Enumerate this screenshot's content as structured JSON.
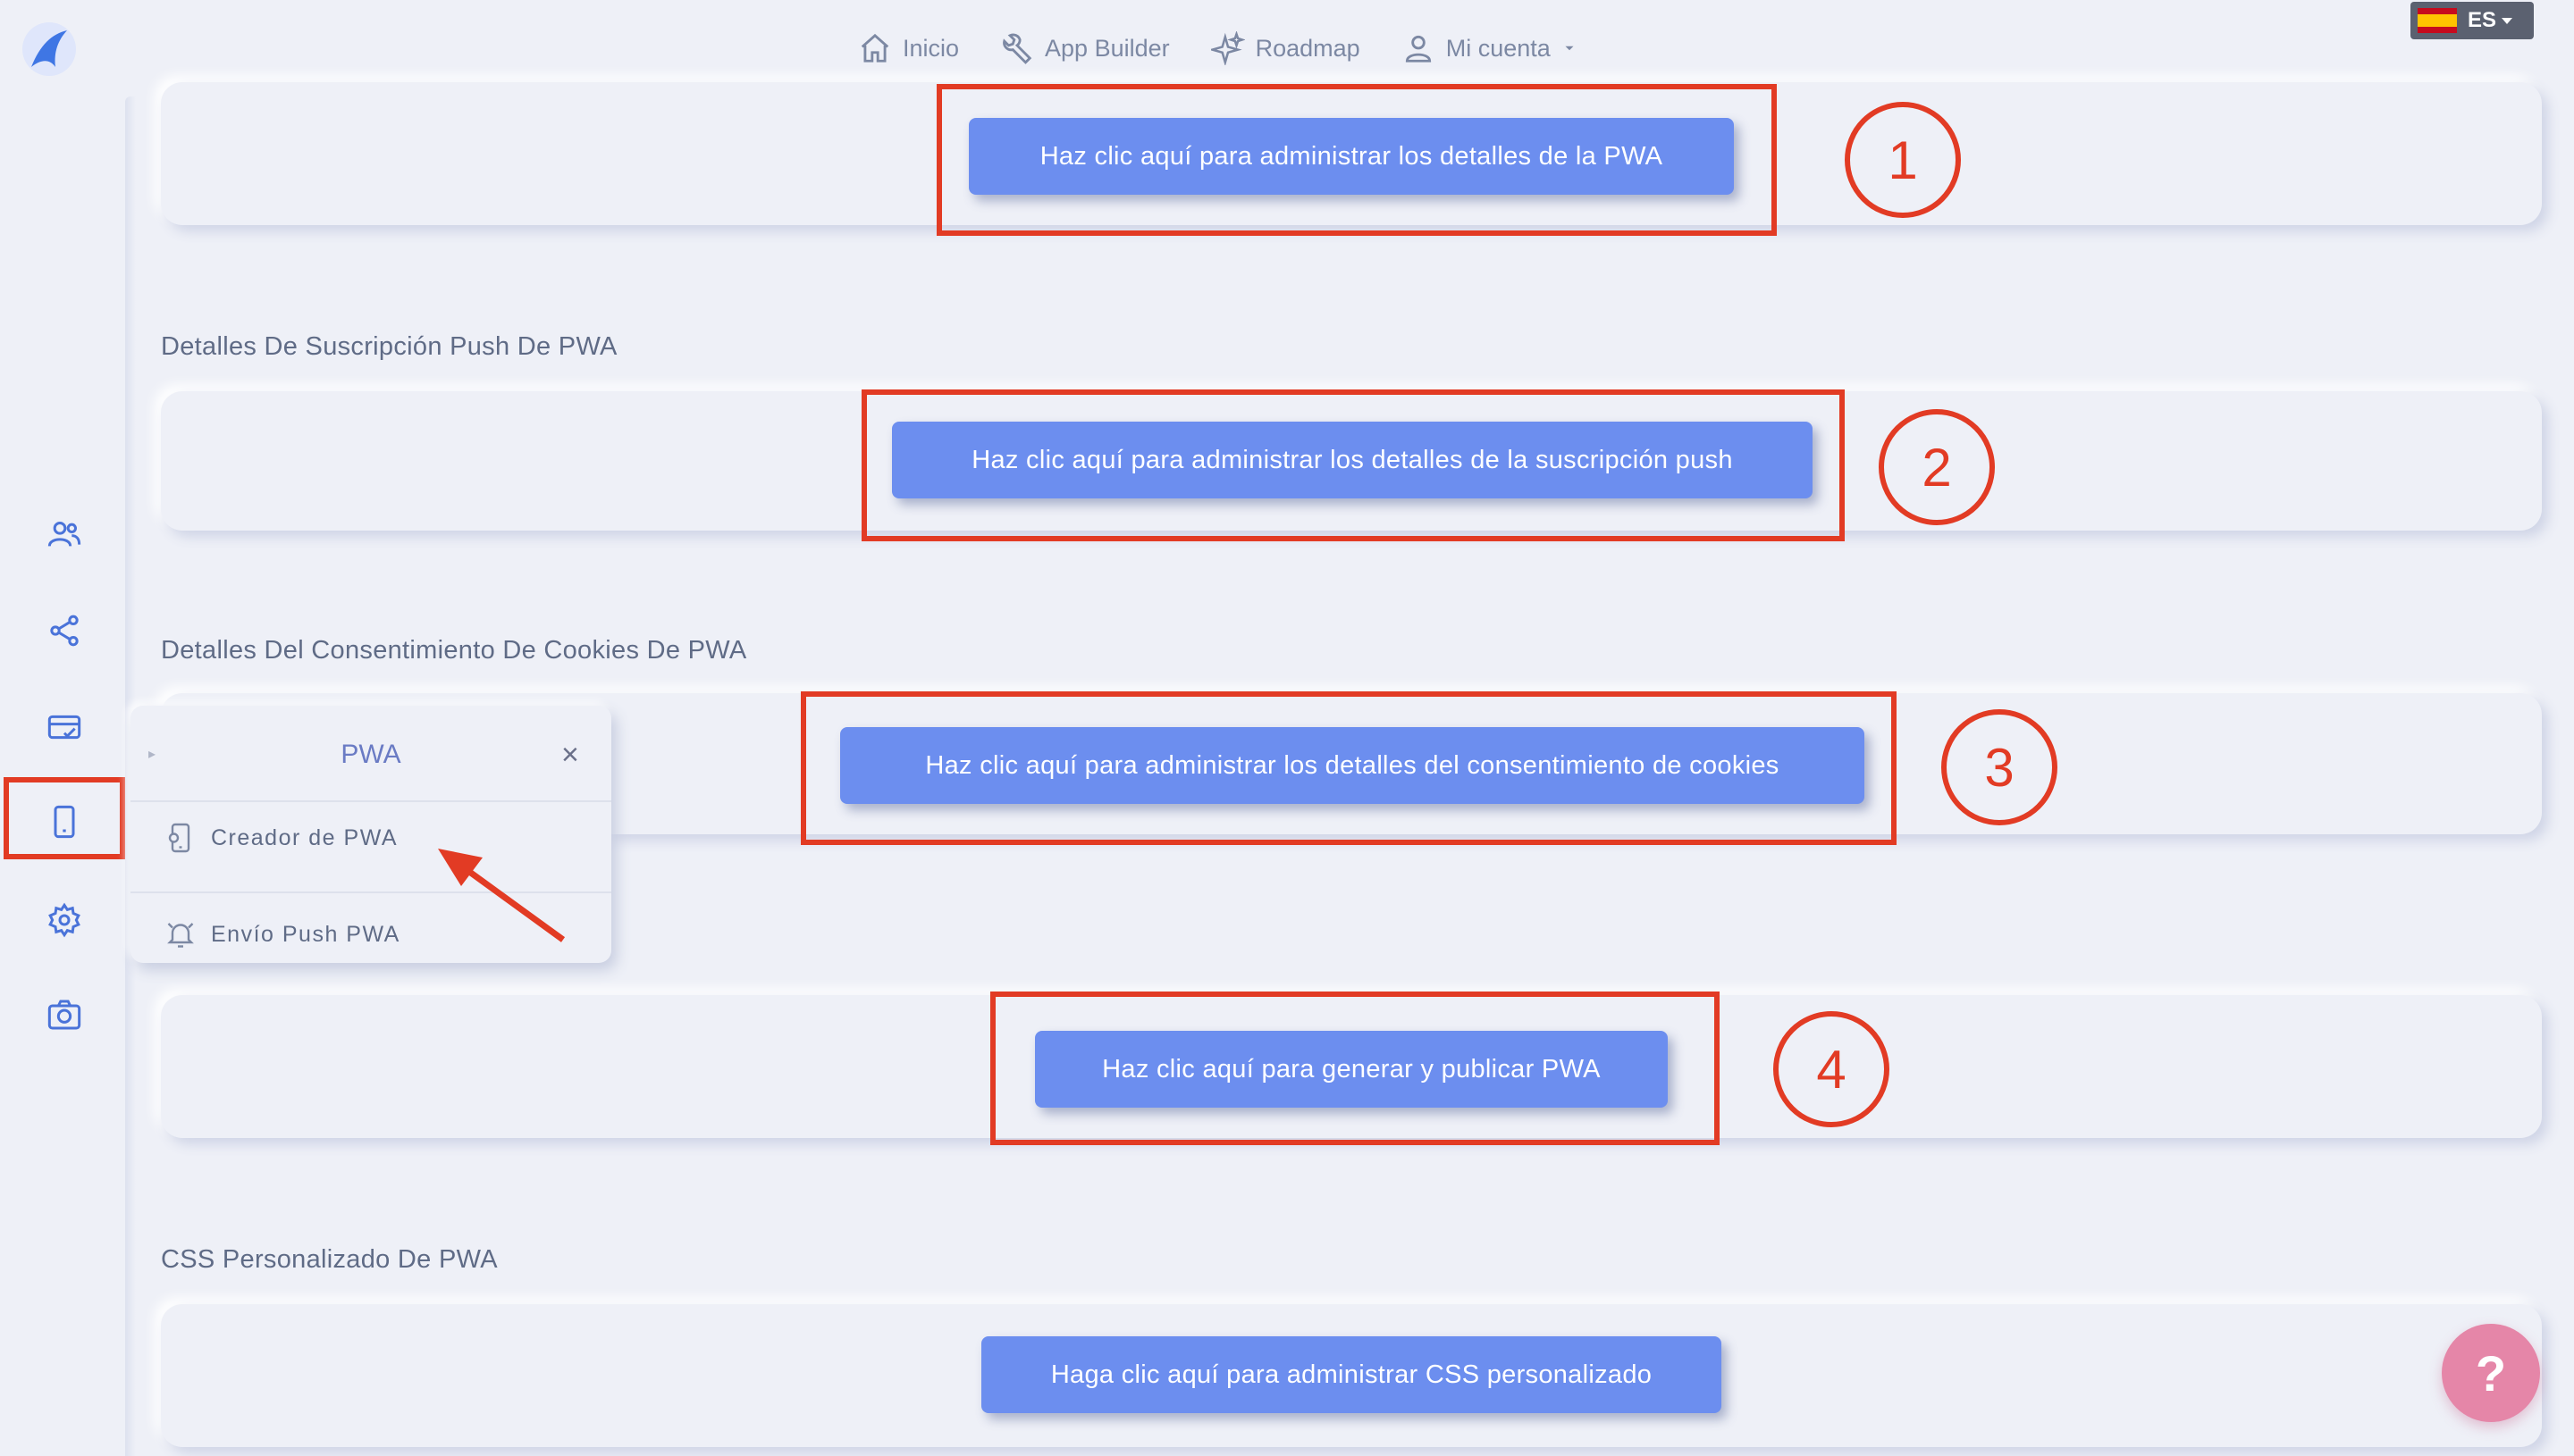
{
  "nav": {
    "inicio": "Inicio",
    "app_builder": "App Builder",
    "roadmap": "Roadmap",
    "mi_cuenta": "Mi cuenta",
    "language": "ES"
  },
  "sections": {
    "push_label": "Detalles De Suscripción Push De PWA",
    "cookies_label": "Detalles Del Consentimiento De Cookies De PWA",
    "css_label": "CSS Personalizado De PWA"
  },
  "buttons": {
    "pwa_details": "Haz clic aquí para administrar los detalles de la PWA",
    "push_details": "Haz clic aquí para administrar los detalles de la suscripción push",
    "cookie_details": "Haz clic aquí para administrar los detalles del consentimiento de cookies",
    "generate_publish": "Haz clic aquí para generar y publicar PWA",
    "custom_css": "Haga clic aquí para administrar CSS personalizado"
  },
  "annotations": {
    "step1": "1",
    "step2": "2",
    "step3": "3",
    "step4": "4"
  },
  "popup": {
    "title": "PWA",
    "close": "×",
    "item_creator": "Creador de PWA",
    "item_push": "Envío Push PWA"
  },
  "help": "?",
  "colors": {
    "accent": "#6c8eef",
    "annotation": "#e23b24",
    "background": "#eef0f7",
    "help": "#e586a8"
  },
  "icons": {
    "sidebar": [
      "users-icon",
      "share-icon",
      "card-icon",
      "phone-icon",
      "gear-icon",
      "camera-icon"
    ]
  }
}
